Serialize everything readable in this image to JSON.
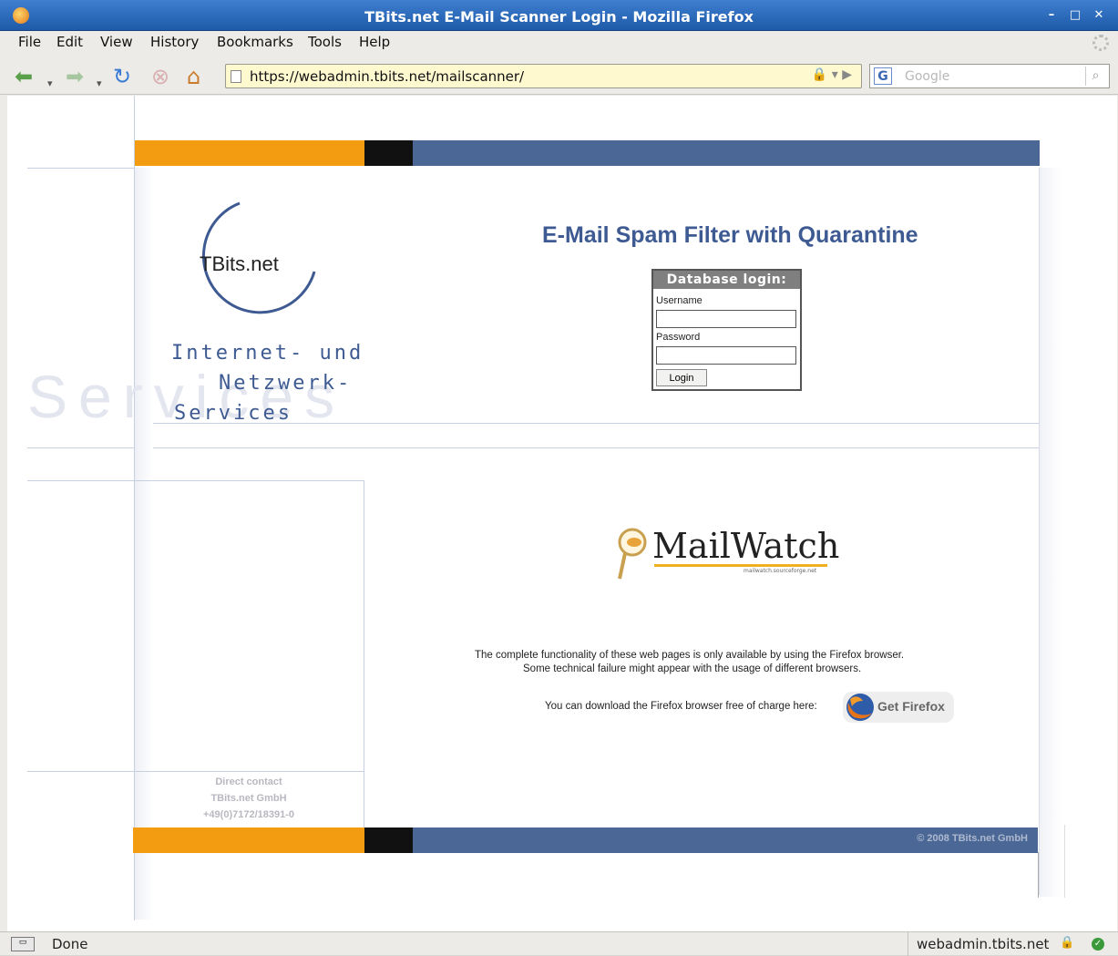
{
  "window": {
    "title": "TBits.net E-Mail Scanner Login - Mozilla Firefox"
  },
  "menu": {
    "file": "File",
    "edit": "Edit",
    "view": "View",
    "history": "History",
    "bookmarks": "Bookmarks",
    "tools": "Tools",
    "help": "Help"
  },
  "nav": {
    "url": "https://webadmin.tbits.net/mailscanner/",
    "search_placeholder": "Google",
    "search_engine_letter": "G"
  },
  "page": {
    "heading": "E-Mail Spam Filter with Quarantine",
    "brand_logo_text": "TBits.net",
    "tagline_line1": "Internet- und",
    "tagline_line2": "Netzwerk-",
    "tagline_line3": "Services",
    "watermark": "Services",
    "login": {
      "title": "Database login:",
      "username_label": "Username",
      "username_value": "",
      "password_label": "Password",
      "password_value": "",
      "submit": "Login"
    },
    "mailwatch_logo": "MailWatch",
    "mailwatch_url": "mailwatch.sourceforge.net",
    "note_line1": "The complete functionality of these web pages is only available by using the Firefox browser.",
    "note_line2": "Some technical failure might appear with the usage of different browsers.",
    "download_text": "You can download the Firefox browser free of charge here:",
    "get_firefox": "Get Firefox",
    "contact_heading": "Direct contact",
    "contact_company": "TBits.net GmbH",
    "contact_phone": "+49(0)7172/18391-0",
    "footer_copyright": "© 2008 TBits.net GmbH"
  },
  "status": {
    "text": "Done",
    "host": "webadmin.tbits.net"
  },
  "colors": {
    "orange": "#f39c12",
    "blue": "#4a6796",
    "heading": "#3e5a92"
  }
}
